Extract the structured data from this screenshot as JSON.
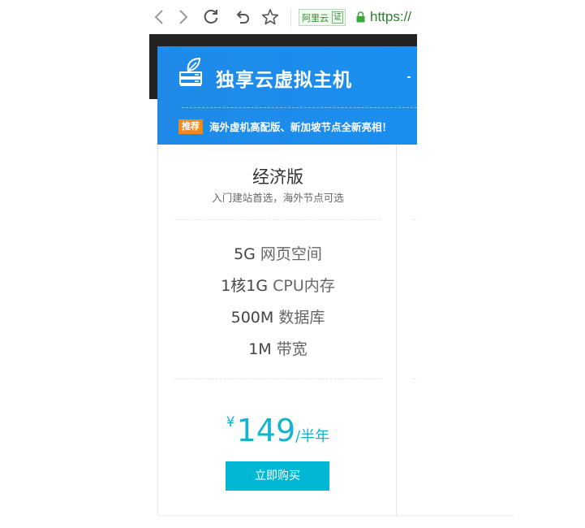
{
  "browser": {
    "back_icon": "chevron-left-icon",
    "forward_icon": "chevron-right-icon",
    "reload_icon": "reload-icon",
    "undo_icon": "undo-icon",
    "bookmark_icon": "star-icon",
    "cert_label": "阿里云",
    "cert_mark": "证",
    "url_prefix": "https://"
  },
  "header": {
    "title": "独享云虚拟主机",
    "promo_tag": "推荐",
    "promo_text": "海外虚机高配版、新加坡节点全新亮相！",
    "icon": "server-leaf-icon"
  },
  "plan": {
    "name": "经济版",
    "subtitle": "入门建站首选，海外节点可选",
    "features": [
      {
        "value": "5G",
        "unit": "网页空间"
      },
      {
        "value": "1核1G",
        "unit": "CPU内存"
      },
      {
        "value": "500M",
        "unit": "数据库"
      },
      {
        "value": "1M",
        "unit": "带宽"
      }
    ],
    "price_currency": "¥",
    "price_value": "149",
    "price_unit": "/半年",
    "buy_label": "立即购买"
  },
  "colors": {
    "header_blue": "#1a8ff0",
    "promo_orange": "#f08a1f",
    "price_cyan": "#14b3d0",
    "button_cyan": "#00b8d4"
  }
}
